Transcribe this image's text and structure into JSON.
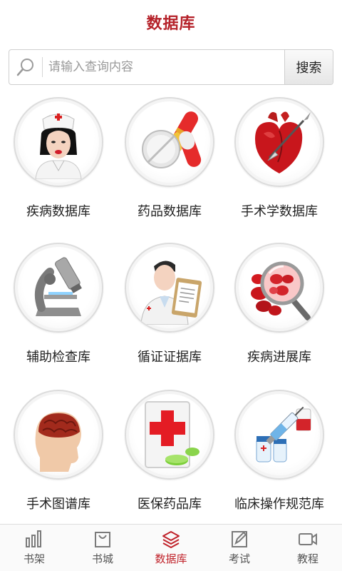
{
  "header": {
    "title": "数据库"
  },
  "search": {
    "placeholder": "请输入查询内容",
    "button_label": "搜索"
  },
  "databases": [
    {
      "label": "疾病数据库",
      "icon": "nurse-icon"
    },
    {
      "label": "药品数据库",
      "icon": "pills-icon"
    },
    {
      "label": "手术学数据库",
      "icon": "heart-scalpel-icon"
    },
    {
      "label": "辅助检查库",
      "icon": "microscope-icon"
    },
    {
      "label": "循证证据库",
      "icon": "doctor-clipboard-icon"
    },
    {
      "label": "疾病进展库",
      "icon": "magnifier-blood-cells-icon"
    },
    {
      "label": "手术图谱库",
      "icon": "brain-head-icon"
    },
    {
      "label": "医保药品库",
      "icon": "medicine-box-icon"
    },
    {
      "label": "临床操作规范库",
      "icon": "syringe-vials-icon"
    }
  ],
  "tabbar": {
    "items": [
      {
        "label": "书架",
        "icon": "bookshelf-icon",
        "active": false
      },
      {
        "label": "书城",
        "icon": "shopping-bag-icon",
        "active": false
      },
      {
        "label": "数据库",
        "icon": "layers-icon",
        "active": true
      },
      {
        "label": "考试",
        "icon": "edit-icon",
        "active": false
      },
      {
        "label": "教程",
        "icon": "video-camera-icon",
        "active": false
      }
    ]
  },
  "colors": {
    "accent": "#c0232b",
    "title": "#b5222a",
    "inactive": "#666666"
  }
}
